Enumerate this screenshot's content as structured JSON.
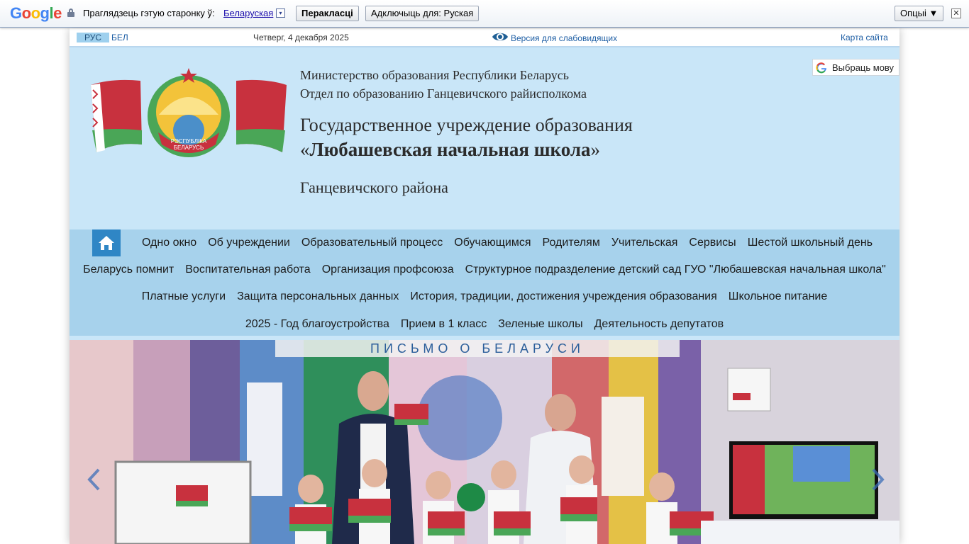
{
  "translate_bar": {
    "logo_letters": [
      "G",
      "o",
      "o",
      "g",
      "l",
      "e"
    ],
    "logo_colors": [
      "#4285f4",
      "#ea4335",
      "#fbbc05",
      "#4285f4",
      "#34a853",
      "#ea4335"
    ],
    "prompt": "Праглядзець гэтую старонку ў:",
    "language": "Беларуская",
    "dropdown_glyph": "▾",
    "translate_button": "Перакласці",
    "disable_button": "Адключыць для: Руская",
    "options_button": "Опцыі ▼",
    "close_glyph": "✕"
  },
  "topline": {
    "lang_ru": "РУС",
    "lang_be": "БЕЛ",
    "date": "Четверг, 4 декабря 2025",
    "low_vision": "Версия для слабовидящих",
    "sitemap": "Карта сайта"
  },
  "header": {
    "ministry": "Министерство образования Республики Беларусь",
    "department": "Отдел по образованию Ганцевичского райисполкома",
    "institution_prefix": "Государственное учреждение образования",
    "quote_open": "«",
    "school_name": "Любашевская начальная школа",
    "quote_close": "»",
    "district": "Ганцевичского района",
    "emblem_text_1": "РЭСПУБЛІКА",
    "emblem_text_2": "БЕЛАРУСЬ",
    "translate_widget": "Выбраць мову"
  },
  "nav": {
    "row1": [
      "Одно окно",
      "Об учреждении",
      "Образовательный процесс",
      "Обучающимся",
      "Родителям",
      "Учительская",
      "Сервисы",
      "Шестой школьный день"
    ],
    "row2": [
      "Беларусь помнит",
      "Воспитательная работа",
      "Организация профсоюза",
      "Структурное подразделение детский сад ГУО \"Любашевская начальная школа\""
    ],
    "row3": [
      "Платные услуги",
      "Защита персональных данных",
      "История, традиции, достижения учреждения образования",
      "Школьное питание"
    ],
    "row4": [
      "2025 - Год благоустройства",
      "Прием в 1 класс",
      "Зеленые школы",
      "Деятельность депутатов"
    ]
  },
  "slider": {
    "banner_text": "ПИСЬМО О БЕЛАРУСИ",
    "prev_icon": "chevron-left-icon",
    "next_icon": "chevron-right-icon"
  },
  "colors": {
    "header_bg": "#c9e6f8",
    "nav_bg": "#a7d2ec",
    "home_bg": "#2f86c5",
    "flag_red": "#c8313e",
    "flag_green": "#4aa657"
  }
}
